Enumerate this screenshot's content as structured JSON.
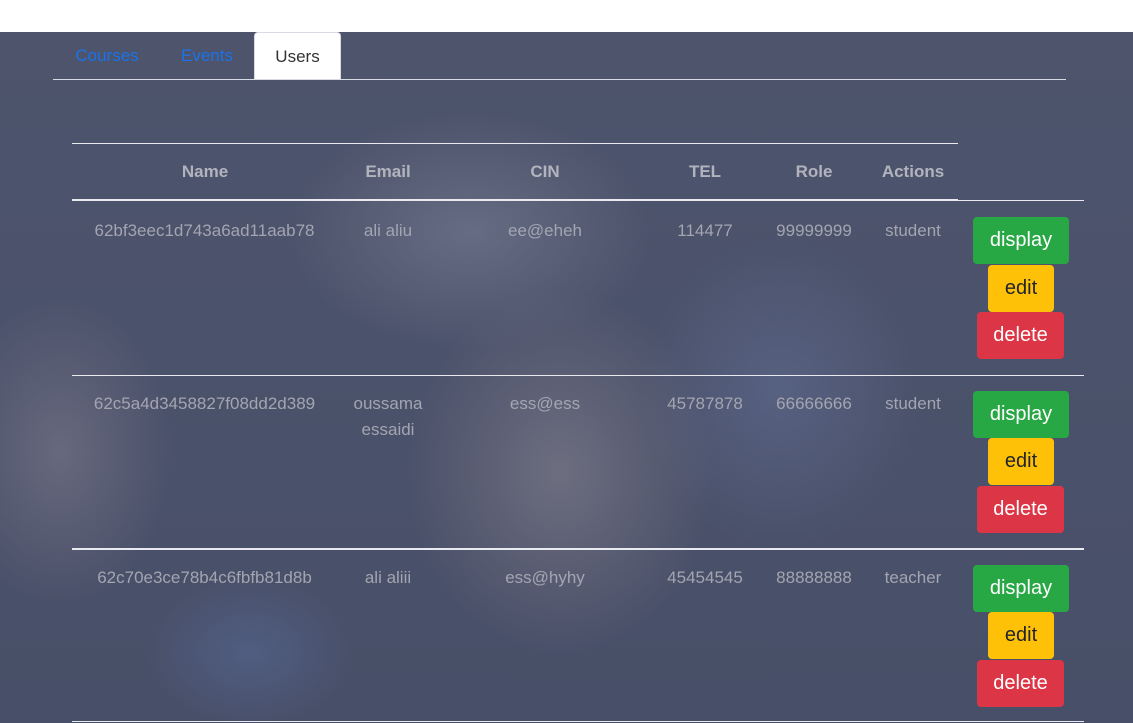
{
  "tabs": [
    {
      "label": "Courses"
    },
    {
      "label": "Events"
    },
    {
      "label": "Users"
    }
  ],
  "table": {
    "headers": [
      "Name",
      "Email",
      "CIN",
      "TEL",
      "Role",
      "Actions"
    ],
    "rows": [
      {
        "id": "62bf3eec1d743a6ad11aab78",
        "name": "ali aliu",
        "email": "ee@eheh",
        "cin": "114477",
        "tel": "99999999",
        "role": "student"
      },
      {
        "id": "62c5a4d3458827f08dd2d389",
        "name": "oussama essaidi",
        "email": "ess@ess",
        "cin": "45787878",
        "tel": "66666666",
        "role": "student"
      },
      {
        "id": "62c70e3ce78b4c6fbfb81d8b",
        "name": "ali aliii",
        "email": "ess@hyhy",
        "cin": "45454545",
        "tel": "88888888",
        "role": "teacher"
      }
    ],
    "actions": {
      "display": "display",
      "edit": "edit",
      "delete": "delete"
    }
  },
  "colors": {
    "display_button": "#28a745",
    "edit_button": "#ffc107",
    "delete_button": "#dc3545",
    "tab_link": "#1a73e8"
  }
}
